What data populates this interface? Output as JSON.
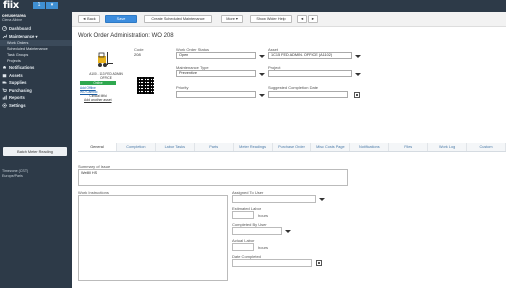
{
  "app": {
    "logo": "fiix"
  },
  "topbar": {
    "buttons": [
      "1",
      "▾"
    ]
  },
  "sidebar": {
    "user_name": "ceruserarea",
    "user_sub": "Ciena Albine",
    "items": [
      {
        "label": "Dashboard",
        "icon": "dashboard-icon"
      },
      {
        "label": "Maintenance ▾",
        "icon": "wrench-icon"
      }
    ],
    "subitems": [
      "Work Orders",
      "Scheduled Maintenance",
      "Task Groups",
      "Projects"
    ],
    "items2": [
      {
        "label": "Notifications",
        "icon": "bell-icon"
      },
      {
        "label": "Assets",
        "icon": "box-icon"
      },
      {
        "label": "Supplies",
        "icon": "truck-icon"
      },
      {
        "label": "Purchasing",
        "icon": "cart-icon"
      },
      {
        "label": "Reports",
        "icon": "chart-icon"
      },
      {
        "label": "Settings",
        "icon": "gear-icon"
      }
    ],
    "batch_button": "Batch Meter Reading",
    "timezone_line1": "Timezone (CST)",
    "timezone_line2": "Europe/Paris"
  },
  "toolbar": {
    "back": "◄ Back",
    "save": "Save",
    "create_sm": "Create Scheduled Maintenance",
    "more": "More ▾",
    "help": "Show Wider Help",
    "prev": "◄",
    "next": "►"
  },
  "page": {
    "title": "Work Order Administration: WO 208"
  },
  "asset_card": {
    "line1": "A100 - 113 FED ADMIN",
    "line2": "OFFICE",
    "status": "Online",
    "link1": "Add Offline",
    "link2": "WO Cambio",
    "line3": "Clinical Mfld",
    "add_asset": "Add another asset"
  },
  "fields": {
    "code_label": "Code",
    "code_value": "208",
    "status_label": "Work Order Status",
    "status_value": "Open",
    "asset_label": "Asset",
    "asset_value": "1C15 FED ADMIN. OFFICE (A1102)",
    "mtype_label": "Maintenance Type",
    "mtype_value": "Preventive",
    "project_label": "Project",
    "project_value": "",
    "priority_label": "Priority",
    "priority_value": "",
    "suggested_label": "Suggested Completion Date",
    "suggested_value": ""
  },
  "tabs": [
    "General",
    "Completion",
    "Labor Tasks",
    "Parts",
    "Meter Readings",
    "Purchase Order",
    "Misc Costs Page",
    "Notifications",
    "Files",
    "Work Log",
    "Custom"
  ],
  "general": {
    "summary_label": "Summary of Issue",
    "summary_value": "Welllll HS",
    "instructions_label": "Work Instructions",
    "assigned_label": "Assigned To User",
    "est_labor_label": "Estimated Labor",
    "hours1": "hours",
    "completed_by_label": "Completed By User",
    "actual_label": "Actual Labor",
    "hours2": "hours",
    "date_completed_label": "Date Completed"
  },
  "colors": {
    "sidebar": "#2d3a48",
    "accent": "#3c8dde",
    "online": "#2fa84f"
  }
}
